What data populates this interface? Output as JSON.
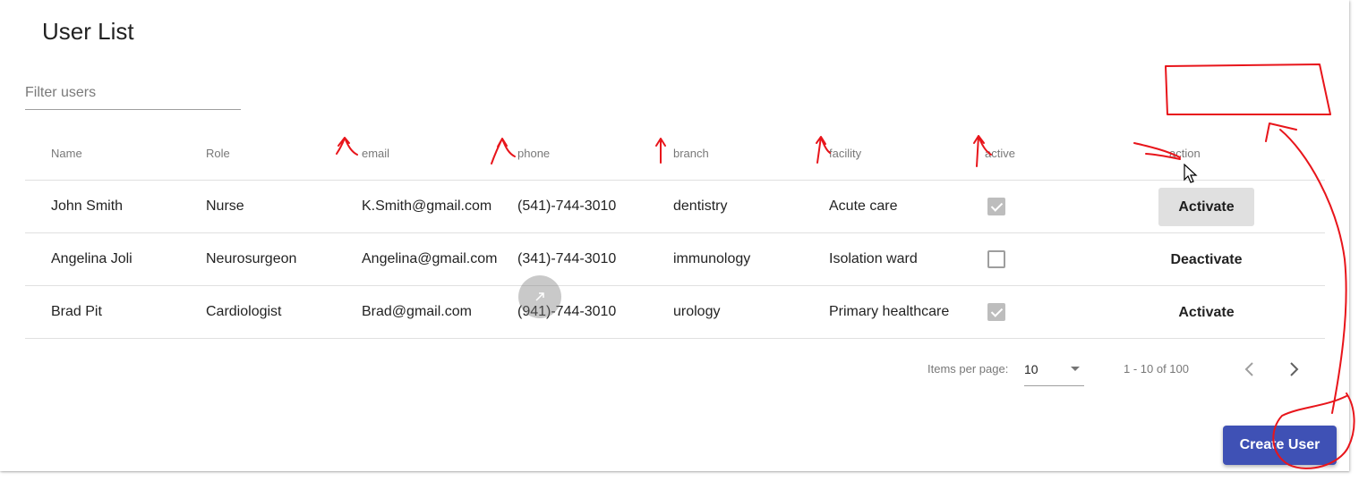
{
  "page": {
    "title": "User List"
  },
  "filter": {
    "placeholder": "Filter users",
    "value": ""
  },
  "table": {
    "headers": [
      "Name",
      "Role",
      "email",
      "phone",
      "branch",
      "facility",
      "active",
      "action"
    ],
    "rows": [
      {
        "name": "John Smith",
        "role": "Nurse",
        "email": "K.Smith@gmail.com",
        "phone": "(541)-744-3010",
        "branch": "dentistry",
        "facility": "Acute care",
        "active": true,
        "action": "Activate"
      },
      {
        "name": "Angelina Joli",
        "role": "Neurosurgeon",
        "email": "Angelina@gmail.com",
        "phone": "(341)-744-3010",
        "branch": "immunology",
        "facility": "Isolation ward",
        "active": false,
        "action": "Deactivate"
      },
      {
        "name": "Brad Pit",
        "role": "Cardiologist",
        "email": "Brad@gmail.com",
        "phone": "(941)-744-3010",
        "branch": "urology",
        "facility": "Primary healthcare",
        "active": true,
        "action": "Activate"
      }
    ]
  },
  "paginator": {
    "items_per_page_label": "Items per page:",
    "page_size": "10",
    "range_label": "1 - 10 of 100"
  },
  "create_button": {
    "label": "Create User"
  },
  "colors": {
    "primary": "#3f51b5",
    "annotation": "#e8151b"
  }
}
